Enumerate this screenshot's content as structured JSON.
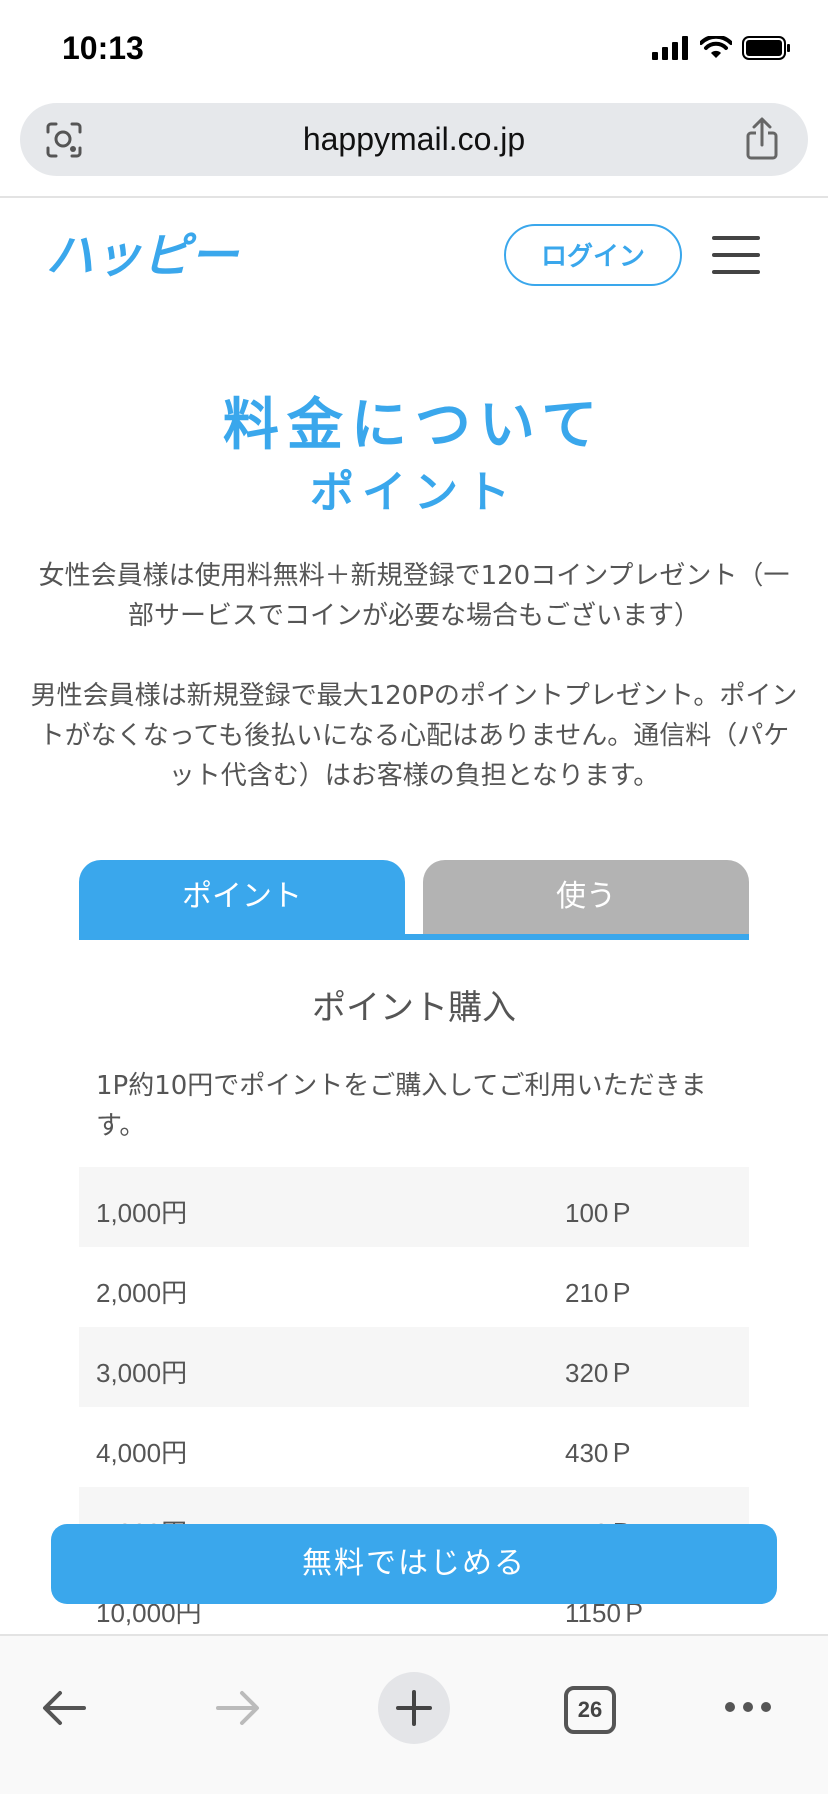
{
  "status_bar": {
    "time": "10:13"
  },
  "browser": {
    "url": "happymail.co.jp",
    "tab_count": "26"
  },
  "header": {
    "logo_text": "ハッピー",
    "login_label": "ログイン"
  },
  "page": {
    "title": "料金について",
    "subtitle": "ポイント",
    "intro_female": "女性会員様は使用料無料＋新規登録で120コインプレゼント（一部サービスでコインが必要な場合もございます）",
    "intro_male": "男性会員様は新規登録で最大120Pのポイントプレゼント。ポイントがなくなっても後払いになる心配はありません。通信料（パケット代含む）はお客様の負担となります。"
  },
  "tabs": [
    {
      "label": "ポイント",
      "active": true
    },
    {
      "label": "使う",
      "active": false
    }
  ],
  "section": {
    "title": "ポイント購入",
    "desc": "1P約10円でポイントをご購入してご利用いただきます。"
  },
  "price_table": [
    {
      "yen": "1,000円",
      "points": "100Ｐ"
    },
    {
      "yen": "2,000円",
      "points": "210Ｐ"
    },
    {
      "yen": "3,000円",
      "points": "320Ｐ"
    },
    {
      "yen": "4,000円",
      "points": "430Ｐ"
    },
    {
      "yen": "5,000円",
      "points": "550Ｐ"
    },
    {
      "yen": "10,000円",
      "points": "1150Ｐ"
    }
  ],
  "cta": {
    "label": "無料ではじめる"
  },
  "colors": {
    "brand": "#3aa7ec",
    "tab_inactive": "#b3b3b3",
    "row_shade": "#f6f6f6"
  }
}
